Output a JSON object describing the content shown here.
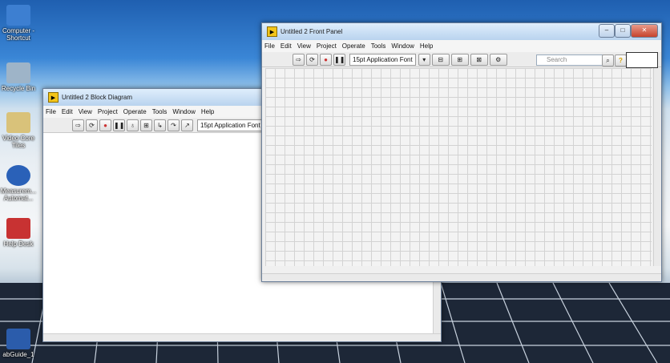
{
  "desktop": {
    "icons": [
      {
        "label": "Computer - Shortcut",
        "color": "#3d7fd1"
      },
      {
        "label": "Recycle Bin",
        "color": "#9eb4c8"
      },
      {
        "label": "Video Core Tiles",
        "color": "#d9c27a"
      },
      {
        "label": "Measurem... Automat...",
        "color": "#2a61b8"
      },
      {
        "label": "Help Desk",
        "color": "#c83232"
      },
      {
        "label": "abGuide_1",
        "color": "#2b5cab"
      }
    ]
  },
  "block_diagram": {
    "title": "Untitled 2 Block Diagram",
    "menu": [
      "File",
      "Edit",
      "View",
      "Project",
      "Operate",
      "Tools",
      "Window",
      "Help"
    ],
    "font_label": "15pt Application Font"
  },
  "front_panel": {
    "title": "Untitled 2 Front Panel",
    "menu": [
      "File",
      "Edit",
      "View",
      "Project",
      "Operate",
      "Tools",
      "Window",
      "Help"
    ],
    "font_label": "15pt Application Font",
    "search_placeholder": "Search"
  }
}
